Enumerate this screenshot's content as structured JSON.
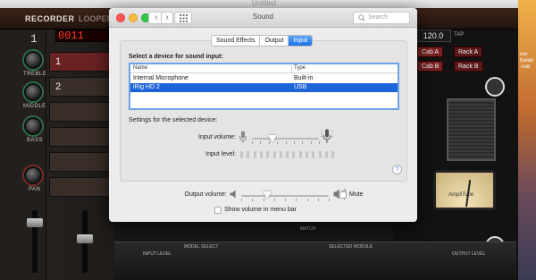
{
  "background_app": {
    "window_title": "Untitled",
    "brand": "RECORDER",
    "tab_looper": "LOOPER",
    "counter": "0011",
    "bpm": "120.0",
    "tap": "TAP",
    "channel_number": "1",
    "tracks": [
      "1",
      "2"
    ],
    "knob_labels": [
      "TREBLE",
      "MIDDLE",
      "BASS",
      "PAN"
    ],
    "cab_buttons": [
      "Cab A",
      "Rack A",
      "Cab B",
      "Rack B"
    ],
    "vu_brand": "AmpliTube",
    "bottom_labels": [
      "INPUT LEVEL",
      "MODEL SELECT",
      "MATCH",
      "SELECTED MODULE",
      "OUTPUT LEVEL"
    ],
    "desktop_text": "ow- lswan -ivat"
  },
  "window": {
    "title": "Sound",
    "search_placeholder": "Search",
    "nav_back": "‹",
    "nav_forward": "›"
  },
  "tabs": [
    {
      "label": "Sound Effects",
      "active": false
    },
    {
      "label": "Output",
      "active": false
    },
    {
      "label": "Input",
      "active": true
    }
  ],
  "input_section": {
    "heading": "Select a device for sound input:",
    "columns": [
      "Name",
      "Type"
    ],
    "devices": [
      {
        "name": "Internal Microphone",
        "type": "Built-in",
        "selected": false
      },
      {
        "name": "iRig HD 2",
        "type": "USB",
        "selected": true
      }
    ],
    "settings_label": "Settings for the selected device:",
    "input_volume_label": "Input volume:",
    "input_volume": 0.3,
    "input_level_label": "Input level:"
  },
  "output": {
    "output_volume_label": "Output volume:",
    "output_volume": 0.3,
    "mute_label": "Mute",
    "mute_checked": false,
    "show_volume_label": "Show volume in menu bar",
    "show_volume_checked": false
  },
  "help_label": "?",
  "colors": {
    "accent": "#1d64d9",
    "recorder_red": "#ff3a2a"
  }
}
